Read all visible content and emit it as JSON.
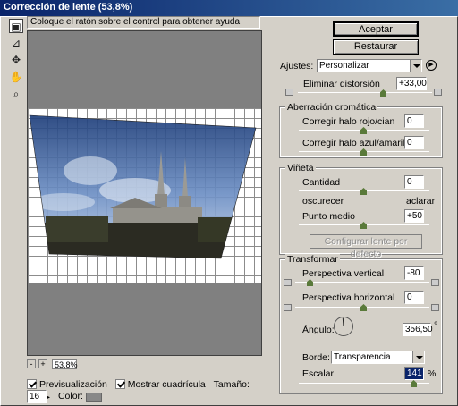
{
  "window": {
    "title": "Corrección de lente (53,8%)"
  },
  "help_text": "Coloque el ratón sobre el control para obtener ayuda",
  "tools": [
    "lens-correction-tool",
    "straighten-tool",
    "move-grid-tool",
    "hand-tool",
    "zoom-tool"
  ],
  "zoom": {
    "minus": "-",
    "plus": "+",
    "value": "53,8%"
  },
  "bottom": {
    "preview_label": "Previsualización",
    "show_grid_label": "Mostrar cuadrícula",
    "size_label": "Tamaño:",
    "size_value": "16",
    "color_label": "Color:",
    "grid_color": "#888888"
  },
  "buttons": {
    "ok": "Aceptar",
    "reset": "Restaurar"
  },
  "settings": {
    "label": "Ajustes:",
    "value": "Personalizar",
    "distortion_label": "Eliminar distorsión",
    "distortion_value": "+33,00"
  },
  "chromatic": {
    "title": "Aberración cromática",
    "red_cyan_label": "Corregir halo rojo/cian",
    "red_cyan_value": "0",
    "blue_yellow_label": "Corregir halo azul/amarillo",
    "blue_yellow_value": "0"
  },
  "vignette": {
    "title": "Viñeta",
    "amount_label": "Cantidad",
    "amount_value": "0",
    "darken_label": "oscurecer",
    "lighten_label": "aclarar",
    "midpoint_label": "Punto medio",
    "midpoint_value": "+50",
    "lens_default_button": "Configurar lente por defecto"
  },
  "transform": {
    "title": "Transformar",
    "vertical_label": "Perspectiva vertical",
    "vertical_value": "-80",
    "horizontal_label": "Perspectiva horizontal",
    "horizontal_value": "0",
    "angle_label": "Ángulo:",
    "angle_value": "356,50",
    "degree_symbol": "°",
    "edge_label": "Borde:",
    "edge_value": "Transparencia",
    "scale_label": "Escalar",
    "scale_value": "141",
    "scale_unit": "%"
  }
}
